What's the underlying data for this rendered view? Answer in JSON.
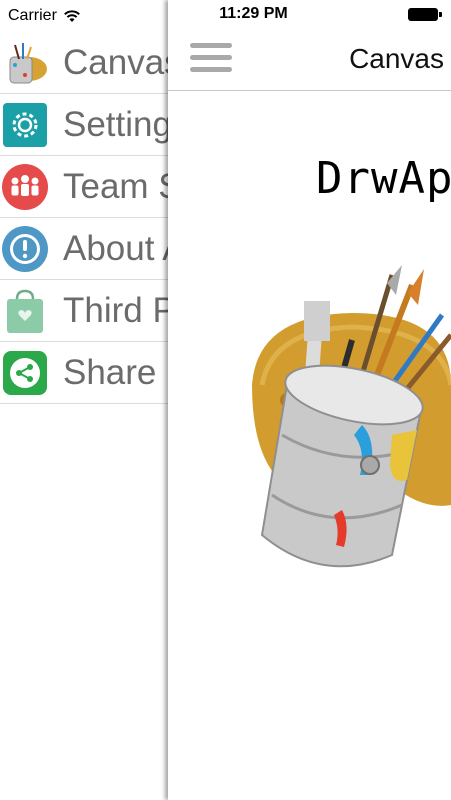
{
  "status_bar": {
    "carrier": "Carrier",
    "time": "11:29 PM"
  },
  "drawer": {
    "items": [
      {
        "label": "Canvas",
        "icon": "paint-bucket-icon"
      },
      {
        "label": "Settings",
        "icon": "settings-gear-icon",
        "color": "#1aa0a6"
      },
      {
        "label": "Team S",
        "icon": "team-icon",
        "color": "#e64b4b"
      },
      {
        "label": "About A",
        "icon": "info-icon",
        "color": "#4f97c5"
      },
      {
        "label": "Third P",
        "icon": "shopping-bag-icon",
        "color": "#8bcba7"
      },
      {
        "label": "Share",
        "icon": "share-icon",
        "color": "#2aa84a"
      }
    ]
  },
  "navbar": {
    "title": "Canvas"
  },
  "main": {
    "app_title": "DrwAp",
    "image_icon": "paint-bucket-palette-illustration"
  }
}
